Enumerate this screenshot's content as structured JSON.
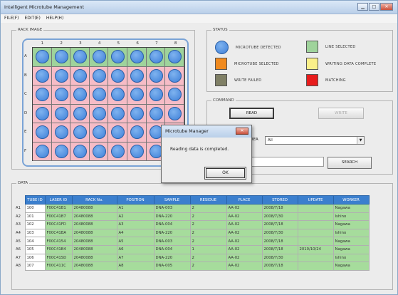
{
  "window": {
    "title": "Intelligent Microtube Management",
    "buttons": [
      "▁",
      "□",
      "✕"
    ]
  },
  "menubar": {
    "items": [
      "FILE(F)",
      "EDIT(E)",
      "HELP(H)"
    ]
  },
  "rack": {
    "label": "RACK IMAGE",
    "columns": [
      "1",
      "2",
      "3",
      "4",
      "5",
      "6",
      "7",
      "8"
    ],
    "rows": [
      "A",
      "B",
      "C",
      "D",
      "E",
      "F"
    ]
  },
  "status": {
    "label": "STATUS",
    "legend": [
      {
        "text": "MICROTUBE DETECTED",
        "color": "#4a8ae0",
        "shape": "circle"
      },
      {
        "text": "LINE SELECTED",
        "color": "#9fd39b",
        "shape": "square"
      },
      {
        "text": "MICROTUBE SELECTED",
        "color": "#f08a1f",
        "shape": "square"
      },
      {
        "text": "WRITING DATA COMPLETE",
        "color": "#fbf08a",
        "shape": "square"
      },
      {
        "text": "WRITE FAILED",
        "color": "#808066",
        "shape": "square"
      },
      {
        "text": "MATCHING",
        "color": "#e81c1c",
        "shape": "square"
      }
    ]
  },
  "command": {
    "label": "COMMAND",
    "read_label": "READ",
    "write_label": "WRITE",
    "area_label": "AREA",
    "area_value": "All",
    "search_label": "SEARCH"
  },
  "data": {
    "label": "DATA",
    "headers": [
      "TUBE ID",
      "LASER ID",
      "RACK No.",
      "POSITION",
      "SAMPLE",
      "RESIDUE",
      "PLACE",
      "STORED",
      "UPDATE",
      "WORKER"
    ],
    "rows": [
      {
        "rn": "A1",
        "cells": [
          "100",
          "F00C41B1",
          "20480088",
          "A1",
          "DNA-003",
          "2",
          "AA-02",
          "2008/7/18",
          "",
          "Nagawa"
        ]
      },
      {
        "rn": "A2",
        "cells": [
          "101",
          "F00C41B7",
          "20480088",
          "A2",
          "DNA-220",
          "2",
          "AA-02",
          "2008/7/30",
          "",
          "Ishino"
        ]
      },
      {
        "rn": "A3",
        "cells": [
          "102",
          "F00C41FD",
          "20480088",
          "A3",
          "DNA-004",
          "2",
          "AA-02",
          "2008/7/18",
          "",
          "Nagawa"
        ]
      },
      {
        "rn": "A4",
        "cells": [
          "103",
          "F00C41BA",
          "20480088",
          "A4",
          "DNA-220",
          "2",
          "AA-02",
          "2008/7/30",
          "",
          "Ishino"
        ]
      },
      {
        "rn": "A5",
        "cells": [
          "104",
          "F00C4154",
          "20480088",
          "A5",
          "DNA-003",
          "2",
          "AA-02",
          "2008/7/18",
          "",
          "Nagawa"
        ]
      },
      {
        "rn": "A6",
        "cells": [
          "105",
          "F00C41B4",
          "20480088",
          "A6",
          "DNA-004",
          "1",
          "AA-02",
          "2008/7/18",
          "2010/10/24",
          "Nagawa"
        ]
      },
      {
        "rn": "A7",
        "cells": [
          "106",
          "F00C41SD",
          "20480088",
          "A7",
          "DNA-220",
          "2",
          "AA-02",
          "2008/7/30",
          "",
          "Ishino"
        ]
      },
      {
        "rn": "A8",
        "cells": [
          "107",
          "F00C411C",
          "20480088",
          "A8",
          "DNA-005",
          "2",
          "AA-02",
          "2008/7/18",
          "",
          "Nagawa"
        ]
      }
    ]
  },
  "dialog": {
    "title": "Microtube Manager",
    "close": "✕",
    "message": "Reading data is completed.",
    "ok_label": "OK"
  }
}
